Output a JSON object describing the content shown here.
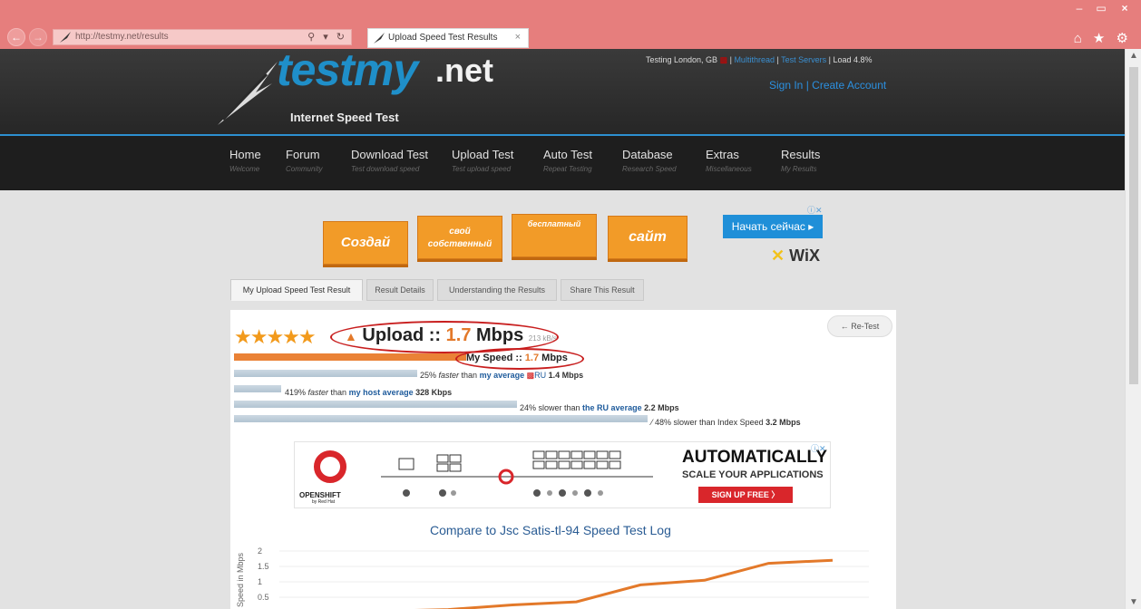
{
  "browser": {
    "url": "http://testmy.net/results",
    "tab_title": "Upload Speed Test Results",
    "tab_close": "×",
    "address_tools": "⚲ ▾ ↻",
    "window_controls": [
      "–",
      "▭",
      "×"
    ],
    "right_controls": "⌂ ★ ⚙",
    "back": "←",
    "forward": "→"
  },
  "header": {
    "logo_text": "testmy",
    "logo_domain": ".net",
    "logo_sub": "Internet Speed Test",
    "testing_location": "Testing London, GB",
    "multithread": "Multithread",
    "test_servers": "Test Servers",
    "load": "Load 4.8%",
    "sign_in": "Sign In",
    "create_account": "Create Account"
  },
  "menu": [
    {
      "title": "Home",
      "sub": "Welcome"
    },
    {
      "title": "Forum",
      "sub": "Community"
    },
    {
      "title": "Download Test",
      "sub": "Test download speed"
    },
    {
      "title": "Upload Test",
      "sub": "Test upload speed"
    },
    {
      "title": "Auto Test",
      "sub": "Repeat Testing"
    },
    {
      "title": "Database",
      "sub": "Research Speed"
    },
    {
      "title": "Extras",
      "sub": "Miscellaneous"
    },
    {
      "title": "Results",
      "sub": "My Results"
    }
  ],
  "ad1": {
    "tiles": [
      "Создай",
      "свой собственный",
      "бесплатный",
      "сайт"
    ],
    "button": "Начать сейчас ▸",
    "brand": "WiX",
    "info": "ⓘ✕"
  },
  "result_tabs": [
    "My Upload Speed Test Result",
    "Result Details",
    "Understanding the Results",
    "Share This Result"
  ],
  "result": {
    "retest": "← Re-Test",
    "stars": "★★★★★",
    "rating": 4.5,
    "upload_label": "Upload ::",
    "upload_value": "1.7",
    "upload_unit": "Mbps",
    "upload_kb": "213 kB/s",
    "my_speed_label": "My Speed ::",
    "my_speed_value": "1.7",
    "my_speed_unit": "Mbps",
    "comparisons": [
      {
        "pre": "25% ",
        "em": "faster",
        "mid": " than ",
        "link": "my average",
        "flag": "RU",
        "post": " 1.4 Mbps",
        "fraction": 0.79
      },
      {
        "pre": "419% ",
        "em": "faster",
        "mid": " than ",
        "link": "my host average",
        "flag": "",
        "post": " 328 Kbps",
        "fraction": 0.19
      },
      {
        "pre": "24% slower than ",
        "em": "",
        "mid": "",
        "link": "the RU average",
        "flag": "",
        "post": " 2.2 Mbps",
        "fraction": 1.0
      },
      {
        "pre": "48% slower than Index Speed ",
        "em": "",
        "mid": "",
        "link": "",
        "flag": "",
        "post": "3.2 Mbps",
        "fraction": 1.0
      }
    ]
  },
  "ad2": {
    "brand": "OPENSHIFT",
    "brand_sub": "by Red Hat",
    "title": "AUTOMATICALLY",
    "subtitle": "SCALE YOUR APPLICATIONS",
    "button": "SIGN UP FREE  〉",
    "info": "ⓘ✕"
  },
  "chart_title": "Compare to Jsc Satis-tl-94 Speed Test Log",
  "chart_data": {
    "type": "line",
    "title": "Compare to Jsc Satis-tl-94 Speed Test Log",
    "ylabel": "Speed in Mbps",
    "yticks": [
      "2",
      "1.5",
      "1",
      "0.5"
    ],
    "ylim": [
      0,
      2
    ],
    "series": [
      {
        "values": [
          0.02,
          0.05,
          0.1,
          0.25,
          0.35,
          0.9,
          1.05,
          1.6,
          1.7
        ],
        "color": "#e3792a"
      }
    ]
  }
}
